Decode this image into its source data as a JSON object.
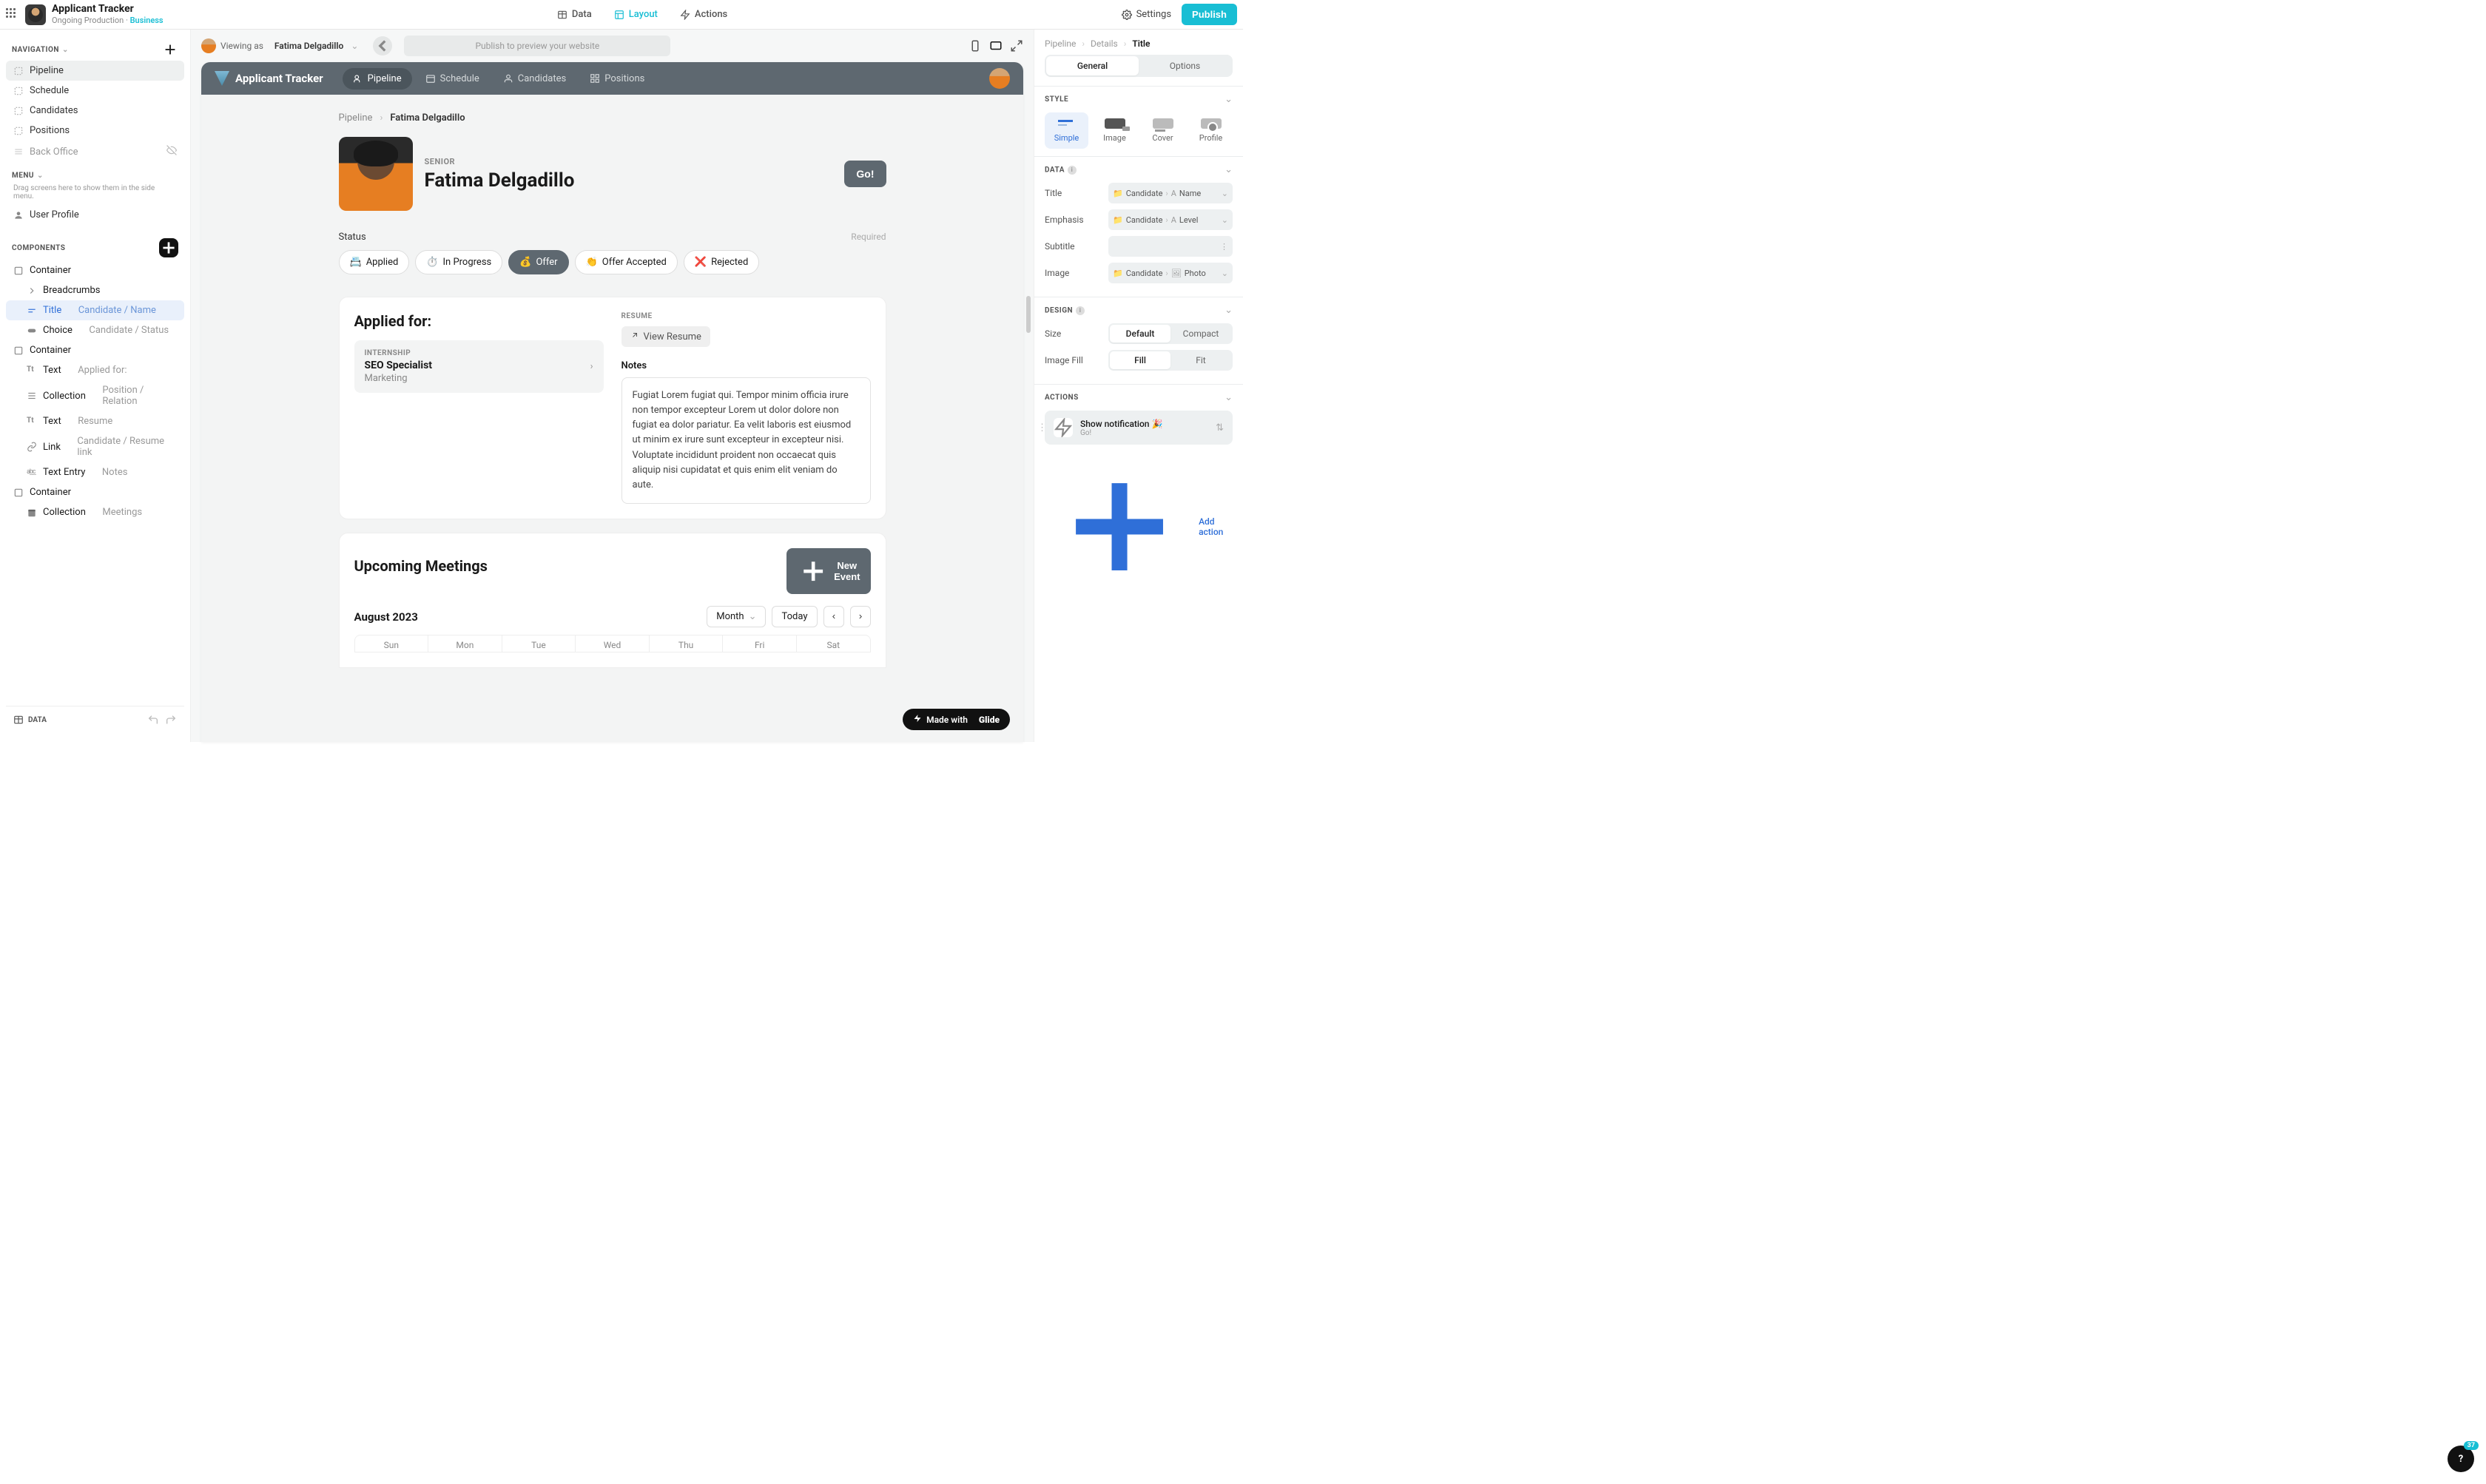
{
  "header": {
    "app_title": "Applicant Tracker",
    "app_sub1": "Ongoing Production",
    "app_sub2": "Business",
    "tabs": {
      "data": "Data",
      "layout": "Layout",
      "actions": "Actions"
    },
    "settings": "Settings",
    "publish": "Publish"
  },
  "left": {
    "navigation_label": "NAVIGATION",
    "nav": [
      "Pipeline",
      "Schedule",
      "Candidates",
      "Positions",
      "Back Office"
    ],
    "menu_label": "MENU",
    "menu_hint": "Drag screens here to show them in the side menu.",
    "menu_items": [
      "User Profile"
    ],
    "components_label": "COMPONENTS",
    "components": [
      {
        "name": "Container",
        "meta": ""
      },
      {
        "name": "Breadcrumbs",
        "meta": ""
      },
      {
        "name": "Title",
        "meta": "Candidate / Name"
      },
      {
        "name": "Choice",
        "meta": "Candidate / Status"
      },
      {
        "name": "Container",
        "meta": ""
      },
      {
        "name": "Text",
        "meta": "Applied for:"
      },
      {
        "name": "Collection",
        "meta": "Position / Relation"
      },
      {
        "name": "Text",
        "meta": "Resume"
      },
      {
        "name": "Link",
        "meta": "Candidate / Resume link"
      },
      {
        "name": "Text Entry",
        "meta": "Notes"
      },
      {
        "name": "Container",
        "meta": ""
      },
      {
        "name": "Collection",
        "meta": "Meetings"
      }
    ],
    "data_btn": "DATA"
  },
  "center": {
    "viewing_as_pre": "Viewing as",
    "viewing_as_name": "Fatima Delgadillo",
    "url_placeholder": "Publish to preview your website",
    "app_name": "Applicant Tracker",
    "app_tabs": [
      "Pipeline",
      "Schedule",
      "Candidates",
      "Positions"
    ],
    "crumb1": "Pipeline",
    "crumb2": "Fatima Delgadillo",
    "emp": "SENIOR",
    "title_name": "Fatima Delgadillo",
    "go": "Go!",
    "status_label": "Status",
    "status_req": "Required",
    "statuses": [
      {
        "emoji": "📇",
        "text": "Applied"
      },
      {
        "emoji": "⏱️",
        "text": "In Progress"
      },
      {
        "emoji": "💰",
        "text": "Offer"
      },
      {
        "emoji": "👏",
        "text": "Offer Accepted"
      },
      {
        "emoji": "❌",
        "text": "Rejected"
      }
    ],
    "applied_for": "Applied for:",
    "pos_tag": "INTERNSHIP",
    "pos_title": "SEO Specialist",
    "pos_dept": "Marketing",
    "resume_label": "RESUME",
    "view_resume": "View Resume",
    "notes_label": "Notes",
    "notes_text": "Fugiat Lorem fugiat qui. Tempor minim officia irure non tempor excepteur Lorem ut dolor dolore non fugiat ea dolor pariatur. Ea velit laboris est eiusmod ut minim ex irure sunt excepteur in excepteur nisi. Voluptate incididunt proident non occaecat quis aliquip nisi cupidatat et quis enim elit veniam do aute.",
    "meetings_title": "Upcoming Meetings",
    "new_event": "New Event",
    "cal_month": "August 2023",
    "cal_view": "Month",
    "cal_today": "Today",
    "days": [
      "Sun",
      "Mon",
      "Tue",
      "Wed",
      "Thu",
      "Fri",
      "Sat"
    ],
    "made_with_pre": "Made with",
    "made_with_brand": "Glide"
  },
  "right": {
    "crumbs": [
      "Pipeline",
      "Details",
      "Title"
    ],
    "tabs": [
      "General",
      "Options"
    ],
    "style_label": "STYLE",
    "styles": [
      "Simple",
      "Image",
      "Cover",
      "Profile"
    ],
    "data_label": "DATA",
    "rows": {
      "title": {
        "label": "Title",
        "src": "Candidate",
        "col": "Name"
      },
      "emphasis": {
        "label": "Emphasis",
        "src": "Candidate",
        "col": "Level"
      },
      "subtitle": {
        "label": "Subtitle"
      },
      "image": {
        "label": "Image",
        "src": "Candidate",
        "col": "Photo"
      }
    },
    "design_label": "DESIGN",
    "size_label": "Size",
    "size_opts": [
      "Default",
      "Compact"
    ],
    "fill_label": "Image Fill",
    "fill_opts": [
      "Fill",
      "Fit"
    ],
    "actions_label": "ACTIONS",
    "action_title": "Show notification 🎉",
    "action_sub": "Go!",
    "add_action": "Add action"
  },
  "help_count": "37"
}
